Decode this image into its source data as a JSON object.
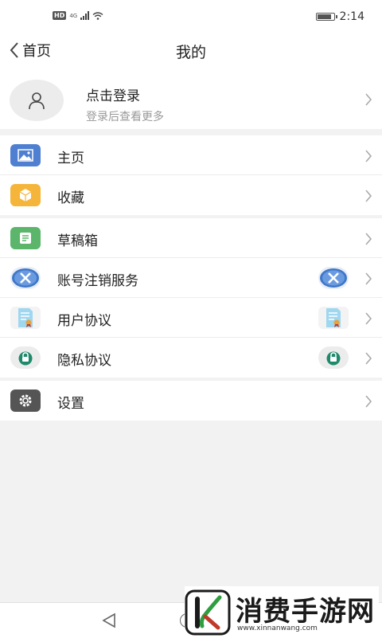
{
  "status_bar": {
    "network_badge": "HD",
    "signal_label": "4G",
    "battery_level_percent": 90,
    "time": "2:14"
  },
  "nav": {
    "back_label": "首页",
    "title": "我的"
  },
  "login": {
    "title": "点击登录",
    "subtitle": "登录后查看更多",
    "icon": "user-icon"
  },
  "sections": [
    {
      "items": [
        {
          "label": "主页",
          "icon": "image-icon",
          "color": "#4f7fd0"
        },
        {
          "label": "收藏",
          "icon": "box-icon",
          "color": "#f5b53a"
        }
      ]
    },
    {
      "items": [
        {
          "label": "草稿箱",
          "icon": "document-icon",
          "color": "#5bb56b"
        },
        {
          "label": "账号注销服务",
          "icon": "x-circle-icon",
          "color": "#3f78c8"
        },
        {
          "label": "用户协议",
          "icon": "certificate-icon",
          "color": "#78c4e6"
        },
        {
          "label": "隐私协议",
          "icon": "lock-icon",
          "color": "#1e8a6c"
        }
      ]
    },
    {
      "items": [
        {
          "label": "设置",
          "icon": "gear-icon",
          "color": "#555555"
        }
      ]
    }
  ],
  "watermark": {
    "name": "消费手游网",
    "url": "www.xinnanwang.com"
  }
}
